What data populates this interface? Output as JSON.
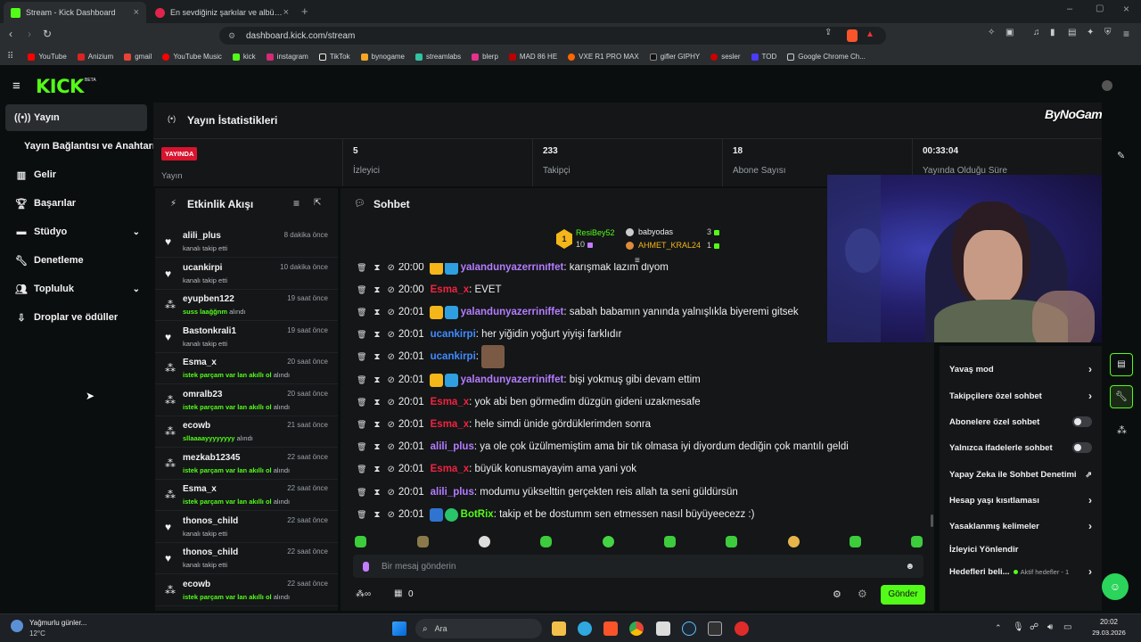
{
  "browser": {
    "tabs": [
      {
        "title": "Stream - Kick Dashboard",
        "active": true
      },
      {
        "title": "En sevdiğiniz şarkılar ve albümleri di",
        "active": false
      }
    ],
    "url": "dashboard.kick.com/stream",
    "bookmarks": [
      "YouTube",
      "Anizium",
      "gmail",
      "YouTube Music",
      "kick",
      "instagram",
      "TikTok",
      "bynogame",
      "streamlabs",
      "blerp",
      "MAD 86 HE",
      "VXE R1 PRO MAX",
      "gifler GIPHY",
      "sesler",
      "TOD",
      "Google Chrome Ch..."
    ]
  },
  "brand": {
    "logo": "KICK",
    "beta": "BETA",
    "accent": "#53fc18"
  },
  "sidebar": {
    "items": [
      {
        "label": "Yayın",
        "icon": "broadcast-icon"
      },
      {
        "label": "Yayın Bağlantısı ve Anahtarı",
        "icon": ""
      },
      {
        "label": "Gelir",
        "icon": "revenue-icon"
      },
      {
        "label": "Başarılar",
        "icon": "trophy-icon"
      },
      {
        "label": "Stüdyo",
        "icon": "studio-icon"
      },
      {
        "label": "Denetleme",
        "icon": "wrench-icon"
      },
      {
        "label": "Topluluk",
        "icon": "community-icon"
      },
      {
        "label": "Droplar ve ödüller",
        "icon": "drops-icon"
      }
    ]
  },
  "stats": {
    "title": "Yayın İstatistikleri",
    "live_badge": "YAYINDA",
    "live_label": "Yayın",
    "viewers": {
      "value": "5",
      "label": "İzleyici"
    },
    "followers": {
      "value": "233",
      "label": "Takipçi"
    },
    "subs": {
      "value": "18",
      "label": "Abone Sayısı"
    },
    "uptime": {
      "value": "00:33:04",
      "label": "Yayında Olduğu Süre"
    }
  },
  "activity": {
    "title": "Etkinlik Akışı",
    "events": [
      {
        "user": "alili_plus",
        "time": "8 dakika önce",
        "text": "kanalı takip etti",
        "type": "follow"
      },
      {
        "user": "ucankirpi",
        "time": "10 dakika önce",
        "text": "kanalı takip etti",
        "type": "follow"
      },
      {
        "user": "eyupben122",
        "time": "19 saat önce",
        "reward": "suss laağğnm",
        "suffix": "alındı",
        "type": "reward"
      },
      {
        "user": "Bastonkrali1",
        "time": "19 saat önce",
        "text": "kanalı takip etti",
        "type": "follow"
      },
      {
        "user": "Esma_x",
        "time": "20 saat önce",
        "reward": "istek parçam var lan akıllı ol",
        "suffix": "alındı",
        "type": "reward"
      },
      {
        "user": "omralb23",
        "time": "20 saat önce",
        "reward": "istek parçam var lan akıllı ol",
        "suffix": "alındı",
        "type": "reward"
      },
      {
        "user": "ecowb",
        "time": "21 saat önce",
        "reward": "sllaaaayyyyyyyy",
        "suffix": "alındı",
        "type": "reward"
      },
      {
        "user": "mezkab12345",
        "time": "22 saat önce",
        "reward": "istek parçam var lan akıllı ol",
        "suffix": "alındı",
        "type": "reward"
      },
      {
        "user": "Esma_x",
        "time": "22 saat önce",
        "reward": "istek parçam var lan akıllı ol",
        "suffix": "alındı",
        "type": "reward"
      },
      {
        "user": "thonos_child",
        "time": "22 saat önce",
        "text": "kanalı takip etti",
        "type": "follow"
      },
      {
        "user": "thonos_child",
        "time": "22 saat önce",
        "text": "kanalı takip etti",
        "type": "follow"
      },
      {
        "user": "ecowb",
        "time": "22 saat önce",
        "reward": "istek parçam var lan akıllı ol",
        "suffix": "alındı",
        "type": "reward"
      }
    ]
  },
  "chat": {
    "title": "Sohbet",
    "leaderboard": [
      {
        "rank": "1",
        "name": "ResiBey52",
        "count": "10"
      },
      {
        "name": "babyodas",
        "count": "3"
      },
      {
        "name": "AHMET_KRAL24",
        "count": "1"
      }
    ],
    "messages": [
      {
        "time": "20:00",
        "user": "yalandunyazerriniffet",
        "color": "#b57cff",
        "text": "karışmak lazım diyom",
        "badges": true
      },
      {
        "time": "20:00",
        "user": "Esma_x",
        "color": "#f0233f",
        "text": "EVET"
      },
      {
        "time": "20:01",
        "user": "yalandunyazerriniffet",
        "color": "#b57cff",
        "text": "sabah babamın yanında yalnışlıkla biyeremi gitsek",
        "badges": true
      },
      {
        "time": "20:01",
        "user": "ucankirpi",
        "color": "#3f8cff",
        "text": "her yiğidin yoğurt yiyişi farklıdır"
      },
      {
        "time": "20:01",
        "user": "ucankirpi",
        "color": "#3f8cff",
        "text": "",
        "emote": true
      },
      {
        "time": "20:01",
        "user": "yalandunyazerriniffet",
        "color": "#b57cff",
        "text": "bişi yokmuş gibi devam ettim",
        "badges": true
      },
      {
        "time": "20:01",
        "user": "Esma_x",
        "color": "#f0233f",
        "text": "yok abi ben görmedim düzgün gideni uzakmesafe"
      },
      {
        "time": "20:01",
        "user": "Esma_x",
        "color": "#f0233f",
        "text": "hele simdi ünide gördüklerimden sonra"
      },
      {
        "time": "20:01",
        "user": "alili_plus",
        "color": "#b57cff",
        "text": "ya ole çok üzülmemiştim ama bir tık olmasa iyi diyordum dediğin çok mantılı geldi"
      },
      {
        "time": "20:01",
        "user": "Esma_x",
        "color": "#f0233f",
        "text": "büyük konusmayayim ama yani yok"
      },
      {
        "time": "20:01",
        "user": "alili_plus",
        "color": "#b57cff",
        "text": "modumu yükselttin gerçekten reis allah ta seni güldürsün"
      },
      {
        "time": "20:01",
        "user": "BotRix",
        "color": "#53fc18",
        "text": "takip et be dostumm sen etmessen nasıl büyüyeecezz :)",
        "bot": true
      }
    ],
    "input_placeholder": "Bir mesaj gönderin",
    "send_label": "Gönder",
    "points": "0"
  },
  "settings": {
    "items": [
      {
        "label": "Yavaş mod",
        "kind": "arrow"
      },
      {
        "label": "Takipçilere özel sohbet",
        "kind": "arrow"
      },
      {
        "label": "Abonelere özel sohbet",
        "kind": "toggle"
      },
      {
        "label": "Yalnızca ifadelerle sohbet",
        "kind": "toggle"
      },
      {
        "label": "Yapay Zeka ile Sohbet Denetimi",
        "kind": "external"
      },
      {
        "label": "Hesap yaşı kısıtlaması",
        "kind": "arrow"
      },
      {
        "label": "Yasaklanmış kelimeler",
        "kind": "arrow"
      },
      {
        "label": "İzleyici Yönlendir",
        "kind": "none"
      },
      {
        "label": "Hedefleri beli...",
        "kind": "arrow",
        "extra": "Aktif hedefler - 1"
      }
    ]
  },
  "overlay": {
    "watermark": "ByNoGame"
  },
  "taskbar": {
    "weather": "Yağmurlu günler...",
    "temp": "12°C",
    "search": "Ara",
    "time": "20:02",
    "date": "29.03.2026"
  }
}
